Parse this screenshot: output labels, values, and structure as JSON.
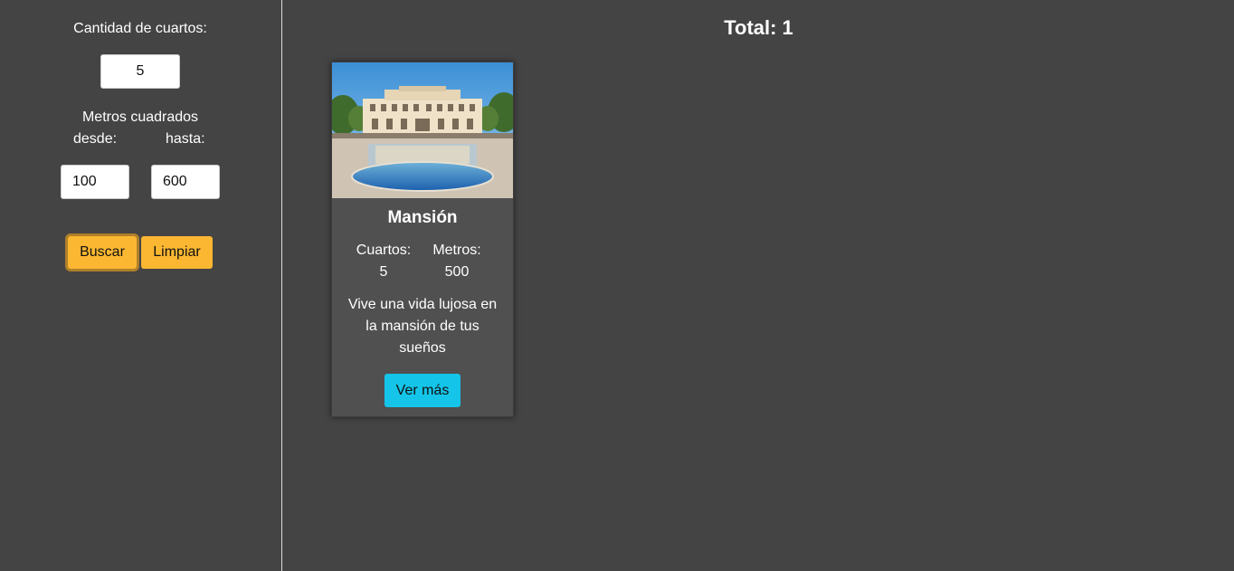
{
  "sidebar": {
    "rooms_label": "Cantidad de cuartos:",
    "rooms_value": "5",
    "meters_label": "Metros cuadrados",
    "from_label": "desde:",
    "to_label": "hasta:",
    "from_value": "100",
    "to_value": "600",
    "search_button": "Buscar",
    "clear_button": "Limpiar"
  },
  "main": {
    "total_label": "Total: 1"
  },
  "cards": [
    {
      "title": "Mansión",
      "rooms_label": "Cuartos:",
      "rooms_value": "5",
      "meters_label": "Metros:",
      "meters_value": "500",
      "description": "Vive una vida lujosa en la mansión de tus sueños",
      "button": "Ver más"
    }
  ],
  "colors": {
    "background": "#444444",
    "card_background": "#505050",
    "primary_button": "#fbb731",
    "detail_button": "#14c5e9"
  }
}
